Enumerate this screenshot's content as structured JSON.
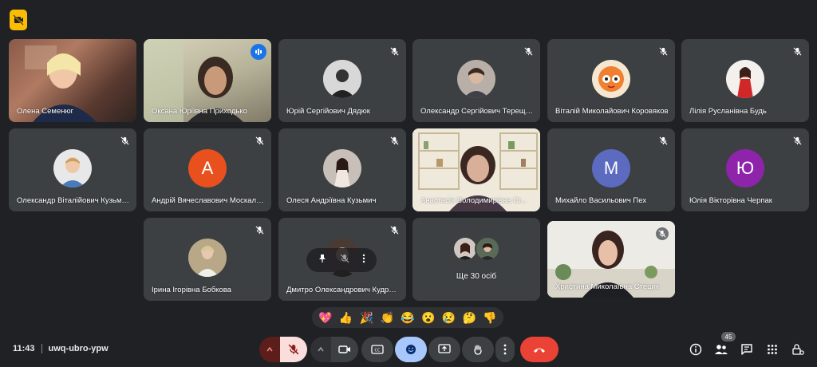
{
  "participants": [
    {
      "name": "Олена Семенюг",
      "type": "video"
    },
    {
      "name": "Оксана Юріївна Приходько",
      "type": "video",
      "speaking": true
    },
    {
      "name": "Юрій Сергійович Дядюк",
      "type": "photo"
    },
    {
      "name": "Олександр Сергійович Терещенко",
      "type": "photo"
    },
    {
      "name": "Віталій Миколайович Коровяков",
      "type": "photo"
    },
    {
      "name": "Лілія Русланівна Будь",
      "type": "photo"
    },
    {
      "name": "Олександр Віталійович Кузьменко",
      "type": "photo"
    },
    {
      "name": "Андрій Вячеславович Москаленко",
      "type": "letter",
      "letter": "А",
      "color": "#e8501e"
    },
    {
      "name": "Олеся Андріївна Кузьмич",
      "type": "photo"
    },
    {
      "name": "Анастасія Володимирівна Сі...",
      "type": "video"
    },
    {
      "name": "Михайло Васильович Пех",
      "type": "letter",
      "letter": "М",
      "color": "#5c6bc0"
    },
    {
      "name": "Юлія Вікторівна Черпак",
      "type": "letter",
      "letter": "Ю",
      "color": "#8e24aa"
    },
    {
      "name": "Ірина Ігорівна Бобкова",
      "type": "photo"
    },
    {
      "name": "Дмитро Олександрович Кудрявцев",
      "type": "photo"
    },
    {
      "name": "Христина Миколаївна Стецик",
      "type": "video"
    }
  ],
  "others": {
    "label": "Ще 30 осіб"
  },
  "reactions": [
    "💖",
    "👍",
    "🎉",
    "👏",
    "😂",
    "😮",
    "😢",
    "🤔",
    "👎"
  ],
  "meeting": {
    "time": "11:43",
    "code": "uwq-ubro-ypw"
  },
  "people_count": "45",
  "colors": {
    "background": "#202124",
    "tile": "#3c4043",
    "end_call": "#ea4335",
    "mic_off": "#f9dedc",
    "active": "#a8c7fa"
  },
  "icons": [
    "no-video-badge-icon",
    "mic-off-icon",
    "speaking-icon",
    "pin-icon",
    "more-vert-icon",
    "chevron-up-icon",
    "camera-icon",
    "captions-icon",
    "emoji-icon",
    "present-icon",
    "hand-icon",
    "end-call-icon",
    "info-icon",
    "people-icon",
    "chat-icon",
    "apps-icon",
    "host-controls-icon"
  ]
}
